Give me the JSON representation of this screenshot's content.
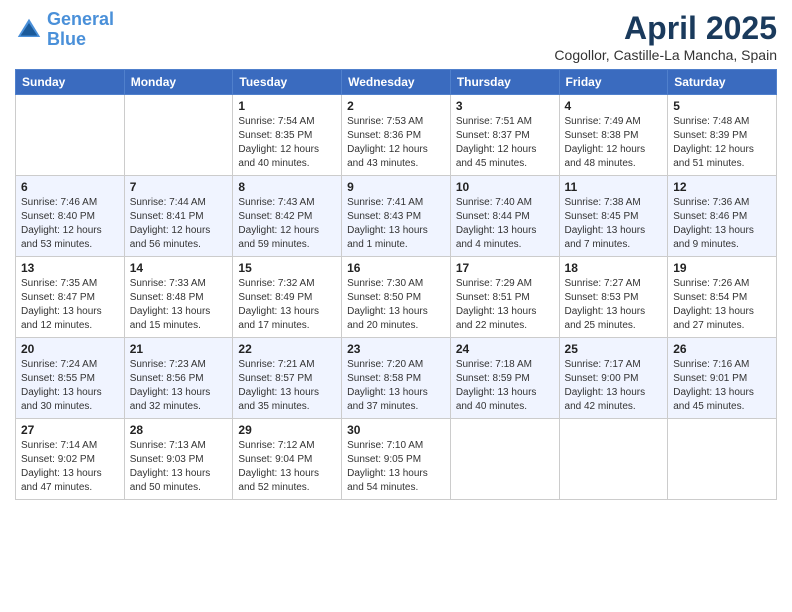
{
  "logo": {
    "line1": "General",
    "line2": "Blue"
  },
  "title": "April 2025",
  "subtitle": "Cogollor, Castille-La Mancha, Spain",
  "headers": [
    "Sunday",
    "Monday",
    "Tuesday",
    "Wednesday",
    "Thursday",
    "Friday",
    "Saturday"
  ],
  "weeks": [
    [
      {
        "day": "",
        "info": ""
      },
      {
        "day": "",
        "info": ""
      },
      {
        "day": "1",
        "info": "Sunrise: 7:54 AM\nSunset: 8:35 PM\nDaylight: 12 hours and 40 minutes."
      },
      {
        "day": "2",
        "info": "Sunrise: 7:53 AM\nSunset: 8:36 PM\nDaylight: 12 hours and 43 minutes."
      },
      {
        "day": "3",
        "info": "Sunrise: 7:51 AM\nSunset: 8:37 PM\nDaylight: 12 hours and 45 minutes."
      },
      {
        "day": "4",
        "info": "Sunrise: 7:49 AM\nSunset: 8:38 PM\nDaylight: 12 hours and 48 minutes."
      },
      {
        "day": "5",
        "info": "Sunrise: 7:48 AM\nSunset: 8:39 PM\nDaylight: 12 hours and 51 minutes."
      }
    ],
    [
      {
        "day": "6",
        "info": "Sunrise: 7:46 AM\nSunset: 8:40 PM\nDaylight: 12 hours and 53 minutes."
      },
      {
        "day": "7",
        "info": "Sunrise: 7:44 AM\nSunset: 8:41 PM\nDaylight: 12 hours and 56 minutes."
      },
      {
        "day": "8",
        "info": "Sunrise: 7:43 AM\nSunset: 8:42 PM\nDaylight: 12 hours and 59 minutes."
      },
      {
        "day": "9",
        "info": "Sunrise: 7:41 AM\nSunset: 8:43 PM\nDaylight: 13 hours and 1 minute."
      },
      {
        "day": "10",
        "info": "Sunrise: 7:40 AM\nSunset: 8:44 PM\nDaylight: 13 hours and 4 minutes."
      },
      {
        "day": "11",
        "info": "Sunrise: 7:38 AM\nSunset: 8:45 PM\nDaylight: 13 hours and 7 minutes."
      },
      {
        "day": "12",
        "info": "Sunrise: 7:36 AM\nSunset: 8:46 PM\nDaylight: 13 hours and 9 minutes."
      }
    ],
    [
      {
        "day": "13",
        "info": "Sunrise: 7:35 AM\nSunset: 8:47 PM\nDaylight: 13 hours and 12 minutes."
      },
      {
        "day": "14",
        "info": "Sunrise: 7:33 AM\nSunset: 8:48 PM\nDaylight: 13 hours and 15 minutes."
      },
      {
        "day": "15",
        "info": "Sunrise: 7:32 AM\nSunset: 8:49 PM\nDaylight: 13 hours and 17 minutes."
      },
      {
        "day": "16",
        "info": "Sunrise: 7:30 AM\nSunset: 8:50 PM\nDaylight: 13 hours and 20 minutes."
      },
      {
        "day": "17",
        "info": "Sunrise: 7:29 AM\nSunset: 8:51 PM\nDaylight: 13 hours and 22 minutes."
      },
      {
        "day": "18",
        "info": "Sunrise: 7:27 AM\nSunset: 8:53 PM\nDaylight: 13 hours and 25 minutes."
      },
      {
        "day": "19",
        "info": "Sunrise: 7:26 AM\nSunset: 8:54 PM\nDaylight: 13 hours and 27 minutes."
      }
    ],
    [
      {
        "day": "20",
        "info": "Sunrise: 7:24 AM\nSunset: 8:55 PM\nDaylight: 13 hours and 30 minutes."
      },
      {
        "day": "21",
        "info": "Sunrise: 7:23 AM\nSunset: 8:56 PM\nDaylight: 13 hours and 32 minutes."
      },
      {
        "day": "22",
        "info": "Sunrise: 7:21 AM\nSunset: 8:57 PM\nDaylight: 13 hours and 35 minutes."
      },
      {
        "day": "23",
        "info": "Sunrise: 7:20 AM\nSunset: 8:58 PM\nDaylight: 13 hours and 37 minutes."
      },
      {
        "day": "24",
        "info": "Sunrise: 7:18 AM\nSunset: 8:59 PM\nDaylight: 13 hours and 40 minutes."
      },
      {
        "day": "25",
        "info": "Sunrise: 7:17 AM\nSunset: 9:00 PM\nDaylight: 13 hours and 42 minutes."
      },
      {
        "day": "26",
        "info": "Sunrise: 7:16 AM\nSunset: 9:01 PM\nDaylight: 13 hours and 45 minutes."
      }
    ],
    [
      {
        "day": "27",
        "info": "Sunrise: 7:14 AM\nSunset: 9:02 PM\nDaylight: 13 hours and 47 minutes."
      },
      {
        "day": "28",
        "info": "Sunrise: 7:13 AM\nSunset: 9:03 PM\nDaylight: 13 hours and 50 minutes."
      },
      {
        "day": "29",
        "info": "Sunrise: 7:12 AM\nSunset: 9:04 PM\nDaylight: 13 hours and 52 minutes."
      },
      {
        "day": "30",
        "info": "Sunrise: 7:10 AM\nSunset: 9:05 PM\nDaylight: 13 hours and 54 minutes."
      },
      {
        "day": "",
        "info": ""
      },
      {
        "day": "",
        "info": ""
      },
      {
        "day": "",
        "info": ""
      }
    ]
  ]
}
